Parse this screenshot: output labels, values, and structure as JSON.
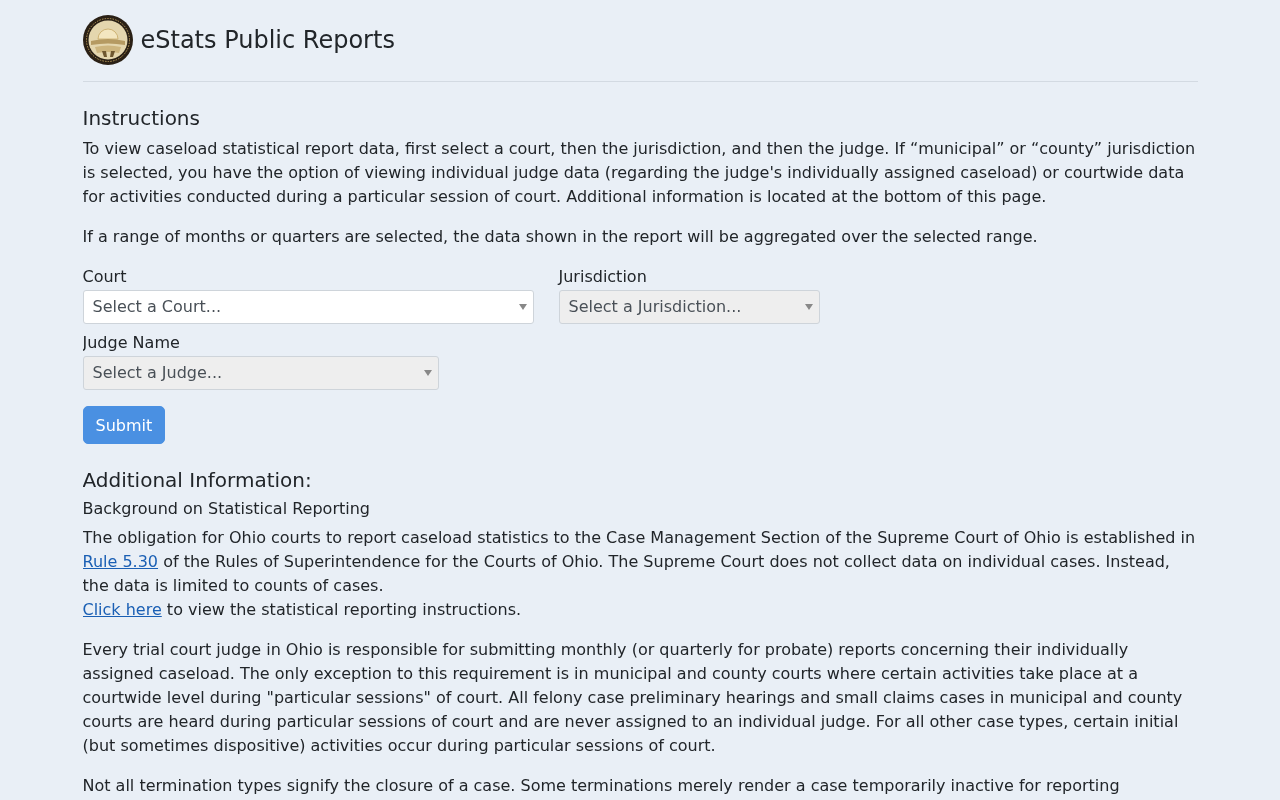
{
  "header": {
    "title": "eStats Public Reports"
  },
  "instructions": {
    "heading": "Instructions",
    "paragraphs": [
      "To view caseload statistical report data, first select a court, then the jurisdiction, and then the judge. If “municipal” or “county” jurisdiction is selected, you have the option of viewing individual judge data (regarding the judge's individually assigned caseload) or courtwide data for activities conducted during a particular session of court. Additional information is located at the bottom of this page.",
      "If a range of months or quarters are selected, the data shown in the report will be aggregated over the selected range."
    ]
  },
  "form": {
    "fields": [
      {
        "label": "Court",
        "placeholder": "Select a Court...",
        "disabled": false
      },
      {
        "label": "Jurisdiction",
        "placeholder": "Select a Jurisdiction...",
        "disabled": true
      },
      {
        "label": "Judge Name",
        "placeholder": "Select a Judge...",
        "disabled": true
      }
    ],
    "submit": "Submit"
  },
  "additional": {
    "heading": "Additional Information:",
    "subheading": "Background on Statistical Reporting",
    "paragraphs": [
      {
        "lines": [
          {
            "segments": [
              {
                "kind": "text",
                "text": "The obligation for Ohio courts to report caseload statistics to the Case Management Section of the Supreme Court of Ohio is established in "
              },
              {
                "kind": "link",
                "text": "Rule 5.30"
              },
              {
                "kind": "text",
                "text": " of the Rules of Superintendence for the Courts of Ohio. The Supreme Court does not collect data on individual cases. Instead, the data is limited to counts of cases."
              }
            ]
          },
          {
            "segments": [
              {
                "kind": "link",
                "text": "Click here"
              },
              {
                "kind": "text",
                "text": " to view the statistical reporting instructions."
              }
            ]
          }
        ]
      },
      {
        "lines": [
          {
            "segments": [
              {
                "kind": "text",
                "text": "Every trial court judge in Ohio is responsible for submitting monthly (or quarterly for probate) reports concerning their individually assigned caseload. The only exception to this requirement is in municipal and county courts where certain activities take place at a courtwide level during \"particular sessions\" of court. All felony case preliminary hearings and small claims cases in municipal and county courts are heard during particular sessions of court and are never assigned to an individual judge. For all other case types, certain initial (but sometimes dispositive) activities occur during particular sessions of court."
              }
            ]
          }
        ]
      },
      {
        "lines": [
          {
            "segments": [
              {
                "kind": "text",
                "text": "Not all termination types signify the closure of a case. Some terminations merely render a case temporarily inactive for reporting"
              }
            ]
          }
        ]
      }
    ]
  }
}
